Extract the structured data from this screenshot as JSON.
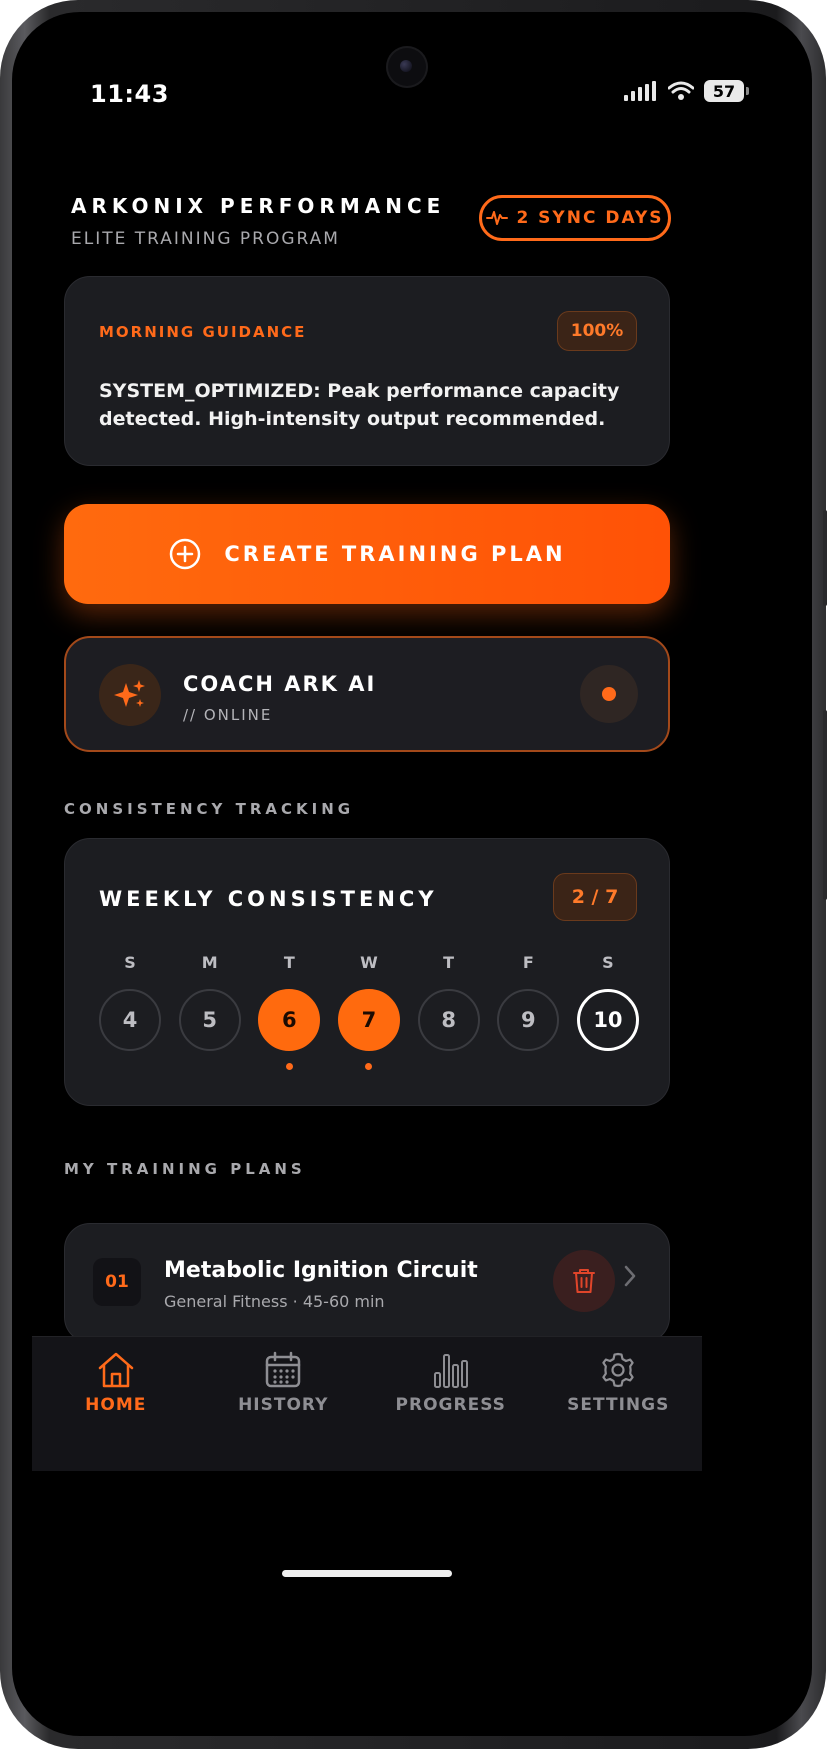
{
  "status": {
    "time": "11:43",
    "battery": "57"
  },
  "header": {
    "title": "ARKONIX PERFORMANCE",
    "subtitle": "ELITE TRAINING PROGRAM",
    "sync_badge": "2 SYNC DAYS"
  },
  "guidance": {
    "label": "MORNING GUIDANCE",
    "percent": "100%",
    "text": "SYSTEM_OPTIMIZED: Peak performance capacity detected. High-intensity output recommended."
  },
  "create_button": {
    "label": "CREATE TRAINING PLAN"
  },
  "coach": {
    "name": "COACH ARK AI",
    "status": "// ONLINE"
  },
  "consistency": {
    "section_label": "CONSISTENCY TRACKING",
    "title": "WEEKLY CONSISTENCY",
    "count": "2 / 7",
    "days": [
      {
        "letter": "S",
        "date": "4",
        "state": "empty"
      },
      {
        "letter": "M",
        "date": "5",
        "state": "empty"
      },
      {
        "letter": "T",
        "date": "6",
        "state": "done"
      },
      {
        "letter": "W",
        "date": "7",
        "state": "done"
      },
      {
        "letter": "T",
        "date": "8",
        "state": "empty"
      },
      {
        "letter": "F",
        "date": "9",
        "state": "empty"
      },
      {
        "letter": "S",
        "date": "10",
        "state": "today"
      }
    ]
  },
  "plans": {
    "section_label": "MY TRAINING PLANS",
    "items": [
      {
        "number": "01",
        "title": "Metabolic Ignition Circuit",
        "subtitle": "General Fitness · 45-60 min"
      }
    ]
  },
  "nav": {
    "items": [
      {
        "label": "HOME",
        "icon": "home-icon",
        "active": true
      },
      {
        "label": "HISTORY",
        "icon": "calendar-icon",
        "active": false
      },
      {
        "label": "PROGRESS",
        "icon": "bar-chart-icon",
        "active": false
      },
      {
        "label": "SETTINGS",
        "icon": "gear-icon",
        "active": false
      }
    ]
  },
  "colors": {
    "accent": "#ff6a1a",
    "background": "#000000",
    "card": "#1c1d21"
  }
}
